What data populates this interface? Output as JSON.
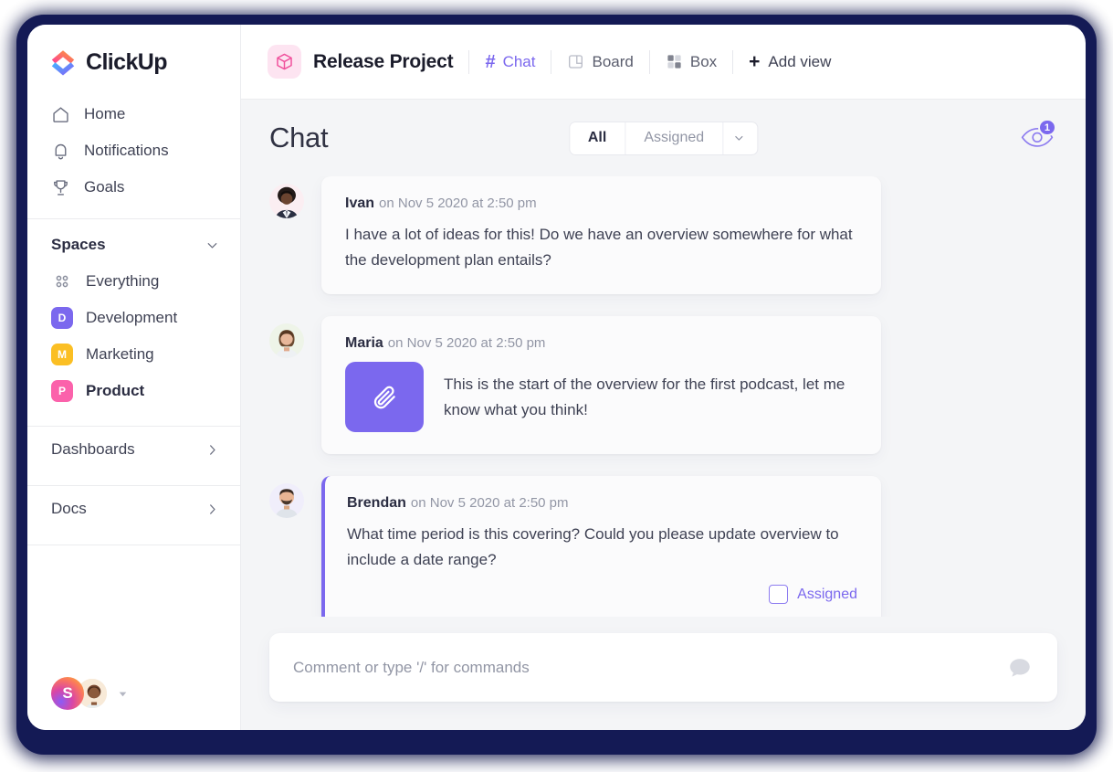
{
  "brand": {
    "name": "ClickUp",
    "accent": "#7b68ee",
    "frame_color": "#141a55"
  },
  "sidebar": {
    "nav": [
      {
        "label": "Home",
        "icon": "home-icon"
      },
      {
        "label": "Notifications",
        "icon": "bell-icon"
      },
      {
        "label": "Goals",
        "icon": "trophy-icon"
      }
    ],
    "spaces_section": {
      "title": "Spaces",
      "icon": "chevron-down-icon"
    },
    "spaces": [
      {
        "label": "Everything",
        "badge": "",
        "color": "",
        "icon": "grid-dots-icon",
        "active": false
      },
      {
        "label": "Development",
        "badge": "D",
        "color": "#7b68ee",
        "active": false
      },
      {
        "label": "Marketing",
        "badge": "M",
        "color": "#fbbf24",
        "active": false
      },
      {
        "label": "Product",
        "badge": "P",
        "color": "#fb62ab",
        "active": true
      }
    ],
    "links": [
      {
        "label": "Dashboards",
        "icon": "chevron-right-icon"
      },
      {
        "label": "Docs",
        "icon": "chevron-right-icon"
      }
    ],
    "footer": {
      "avatar_initial": "S",
      "caret": "caret-down-icon"
    }
  },
  "topbar": {
    "project_icon": "box-icon",
    "project_title": "Release Project",
    "views": [
      {
        "label": "Chat",
        "icon": "hash-icon",
        "active": true
      },
      {
        "label": "Board",
        "icon": "board-icon",
        "active": false
      },
      {
        "label": "Box",
        "icon": "box-grid-icon",
        "active": false
      }
    ],
    "add_view": {
      "label": "Add view",
      "icon": "plus-icon"
    }
  },
  "panel": {
    "title": "Chat",
    "filters": {
      "all": "All",
      "assigned": "Assigned",
      "caret": "chevron-down-icon"
    },
    "watchers": {
      "icon": "eye-icon",
      "count": "1"
    }
  },
  "messages": [
    {
      "author": "Ivan",
      "timestamp": "on Nov 5 2020 at 2:50 pm",
      "text": "I have a lot of ideas for this! Do we have an overview somewhere for what the development plan entails?",
      "avatar": "avatar-ivan",
      "has_attachment": false,
      "accent": false
    },
    {
      "author": "Maria",
      "timestamp": "on Nov 5 2020 at 2:50 pm",
      "text": "This is the start of the overview for the first podcast, let me know what you think!",
      "avatar": "avatar-maria",
      "has_attachment": true,
      "attachment_icon": "paperclip-icon",
      "accent": false
    },
    {
      "author": "Brendan",
      "timestamp": "on Nov 5 2020 at 2:50 pm",
      "text": "What time period is this covering? Could you please update overview to include a date range?",
      "avatar": "avatar-brendan",
      "has_attachment": false,
      "accent": true,
      "assigned_label": "Assigned"
    }
  ],
  "composer": {
    "placeholder": "Comment or type '/' for commands",
    "icon": "chat-bubble-icon"
  }
}
